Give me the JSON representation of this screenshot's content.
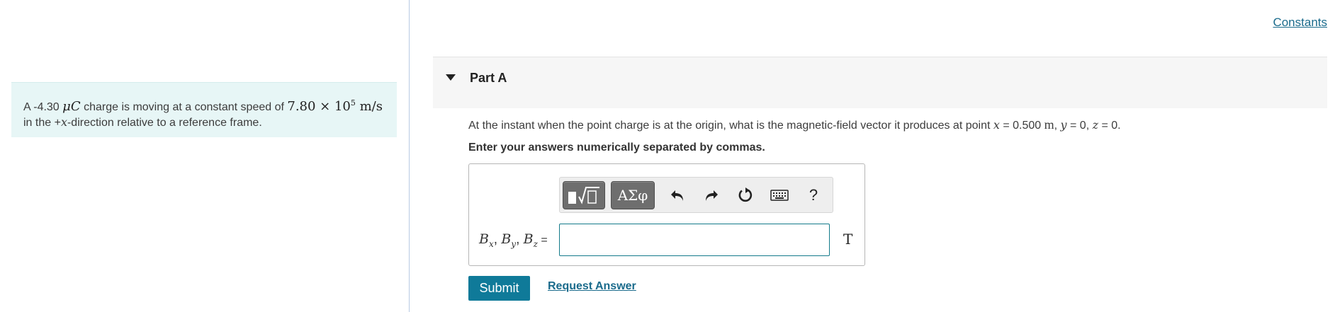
{
  "header": {
    "constants_link": "Constants"
  },
  "problem": {
    "prefix": "A -4.30 ",
    "charge_unit": "μC",
    "middle": " charge is moving at a constant speed of ",
    "speed_mantissa": "7.80 × 10",
    "speed_exponent": "5",
    "speed_unit": " m/s",
    "line2_prefix": "in the +",
    "line2_var": "x",
    "line2_suffix": "-direction relative to a reference frame."
  },
  "part": {
    "title": "Part A",
    "question": {
      "prefix": "At the instant when the point charge is at the origin, what is the magnetic-field vector it produces at point ",
      "x_var": "x",
      "x_value": " = 0.500 ",
      "x_unit": "m",
      "y_var": "y",
      "y_value": " = 0, ",
      "z_var": "z",
      "z_value": " = 0."
    },
    "instruction": "Enter your answers numerically separated by commas.",
    "answer": {
      "vars": [
        {
          "base": "B",
          "sub": "x"
        },
        {
          "base": "B",
          "sub": "y"
        },
        {
          "base": "B",
          "sub": "z"
        }
      ],
      "equals": " =",
      "input_value": "",
      "unit": "T"
    },
    "toolbar": {
      "symbols_label": "ΑΣφ",
      "undo_icon": "↶",
      "redo_icon": "↷",
      "reset_icon": "⟳",
      "help_label": "?"
    },
    "submit_label": "Submit",
    "request_answer_label": "Request Answer"
  }
}
